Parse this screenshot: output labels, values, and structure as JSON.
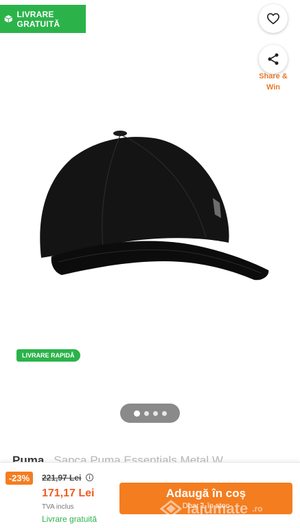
{
  "badges": {
    "free_shipping": "LIVRARE GRATUITĂ",
    "fast_delivery": "LIVRARE RAPIDĂ"
  },
  "actions": {
    "share_label": "Share & Win"
  },
  "gallery": {
    "image_count": 4,
    "active_index": 0
  },
  "product": {
    "brand": "Puma",
    "title": "Sapca Puma Essentials Metal W"
  },
  "pricing": {
    "discount": "-23%",
    "old_price": "221,97 Lei",
    "price": "171,17 Lei",
    "vat_note": "TVA inclus",
    "delivery_note": "Livrare gratuită"
  },
  "cart": {
    "button_label": "Adaugă în coș",
    "stock_note": "Doar 1 în stoc"
  },
  "watermark": {
    "text": "lajumate",
    "suffix": ".ro"
  },
  "colors": {
    "green": "#2bb34a",
    "orange": "#f47d20",
    "price_red": "#f15a22"
  }
}
